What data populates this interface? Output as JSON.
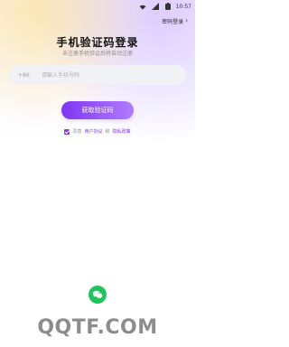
{
  "status_bar": {
    "time": "10:57",
    "icons": [
      "wifi-icon",
      "signal-icon",
      "battery-icon"
    ]
  },
  "header": {
    "password_login_label": "密码登录"
  },
  "login": {
    "title": "手机验证码登录",
    "subtitle": "未注册手机验证后将自动注册",
    "country_code": "+86",
    "phone_placeholder": "请输入手机号码",
    "get_code_button": "获取验证码"
  },
  "agreement": {
    "prefix": "同意",
    "user_agreement": "用户协议",
    "and": "和",
    "privacy_policy": "隐私政策"
  },
  "social": {
    "wechat_icon": "wechat-icon"
  },
  "watermark": {
    "text": "QQTF.COM"
  },
  "colors": {
    "accent": "#7f35f3",
    "accent_light": "#b07cff",
    "wechat": "#22c35e"
  }
}
